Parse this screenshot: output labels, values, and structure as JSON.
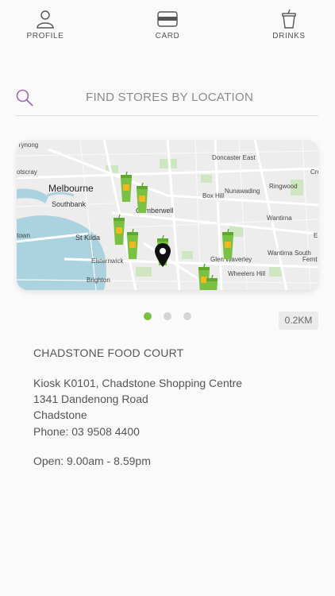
{
  "nav": {
    "profile": {
      "label": "PROFILE",
      "icon": "person-icon"
    },
    "card": {
      "label": "CARD",
      "icon": "card-icon"
    },
    "drinks": {
      "label": "DRINKS",
      "icon": "cup-icon"
    }
  },
  "search": {
    "placeholder": "FIND STORES BY LOCATION",
    "icon": "search-icon"
  },
  "map": {
    "labels": {
      "craigieburn_part": "Tynong",
      "footscray_part": "otscray",
      "melbourne": "Melbourne",
      "southbank": "Southbank",
      "camberwell": "Camberwell",
      "doncaster_east": "Doncaster East",
      "box_hill": "Box Hill",
      "nunawading": "Nunawading",
      "ringwood": "Ringwood",
      "wantirna": "Wantirna",
      "wantirna_south": "Wantirna South",
      "ferntree": "Fernt",
      "st_kilda": "St Kilda",
      "elsternwick": "Elsternwick",
      "glen_waverley": "Glen Waverley",
      "wheelers_hill": "Wheelers Hill",
      "brighton": "Brighton",
      "town": "town",
      "croydon_part": "Cro",
      "e_part": "E"
    },
    "markers": {
      "store_icon": "boost-cup-marker-icon",
      "selected_icon": "location-pin-icon"
    },
    "colors": {
      "water": "#aad3df",
      "land": "#ededed",
      "park": "#cfe6c2",
      "road": "#ffffff",
      "marker": "#7ac143"
    }
  },
  "pager": {
    "count": 3,
    "active": 0,
    "active_color": "#7ac143"
  },
  "store": {
    "distance": "0.2KM",
    "name": "CHADSTONE FOOD COURT",
    "address_line1": "Kiosk K0101, Chadstone Shopping Centre",
    "address_line2": "1341 Dandenong Road",
    "address_line3": "Chadstone",
    "phone": "Phone: 03 9508 4400",
    "hours": "Open: 9.00am - 8.59pm"
  }
}
